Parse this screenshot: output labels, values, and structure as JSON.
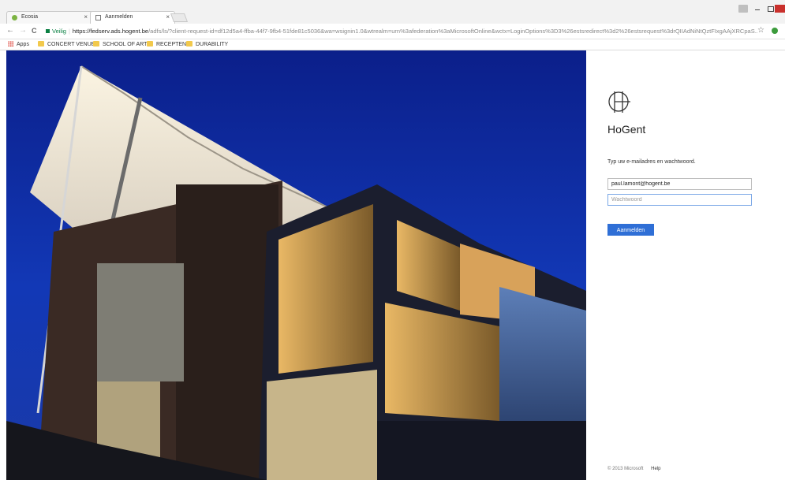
{
  "browser": {
    "tabs": [
      {
        "title": "Ecosia",
        "close": "×"
      },
      {
        "title": "Aanmelden",
        "close": "×"
      }
    ],
    "back": "←",
    "forward": "→",
    "reload": "C",
    "secure_label": "Veilig",
    "url_host": "https://fedserv.ads.hogent.be",
    "url_path": "/adfs/ls/?client-request-id=df12d5a4-ffba-44f7-9fb4-51fde81c5036&wa=wsignin1.0&wtrealm=urn%3afederation%3aMicrosoftOnline&wctx=LoginOptions%3D3%26estsredirect%3d2%26estsrequest%3drQIIAdNiNtQztFIxgAAjXRCpaS...",
    "star": "☆",
    "bookmarks": [
      {
        "label": "Apps"
      },
      {
        "label": "CONCERT VENUES"
      },
      {
        "label": "SCHOOL OF ARTS"
      },
      {
        "label": "RECEPTEN"
      },
      {
        "label": "DURABILITY"
      }
    ]
  },
  "login": {
    "brand": "HoGent",
    "prompt": "Typ uw e-mailadres en wachtwoord.",
    "email_value": "paul.lamont@hogent.be",
    "password_placeholder": "Wachtwoord",
    "submit_label": "Aanmelden",
    "footer_copyright": "© 2013 Microsoft",
    "footer_help": "Help"
  },
  "colors": {
    "accent": "#2f6fd6",
    "secure": "#0b8043"
  }
}
